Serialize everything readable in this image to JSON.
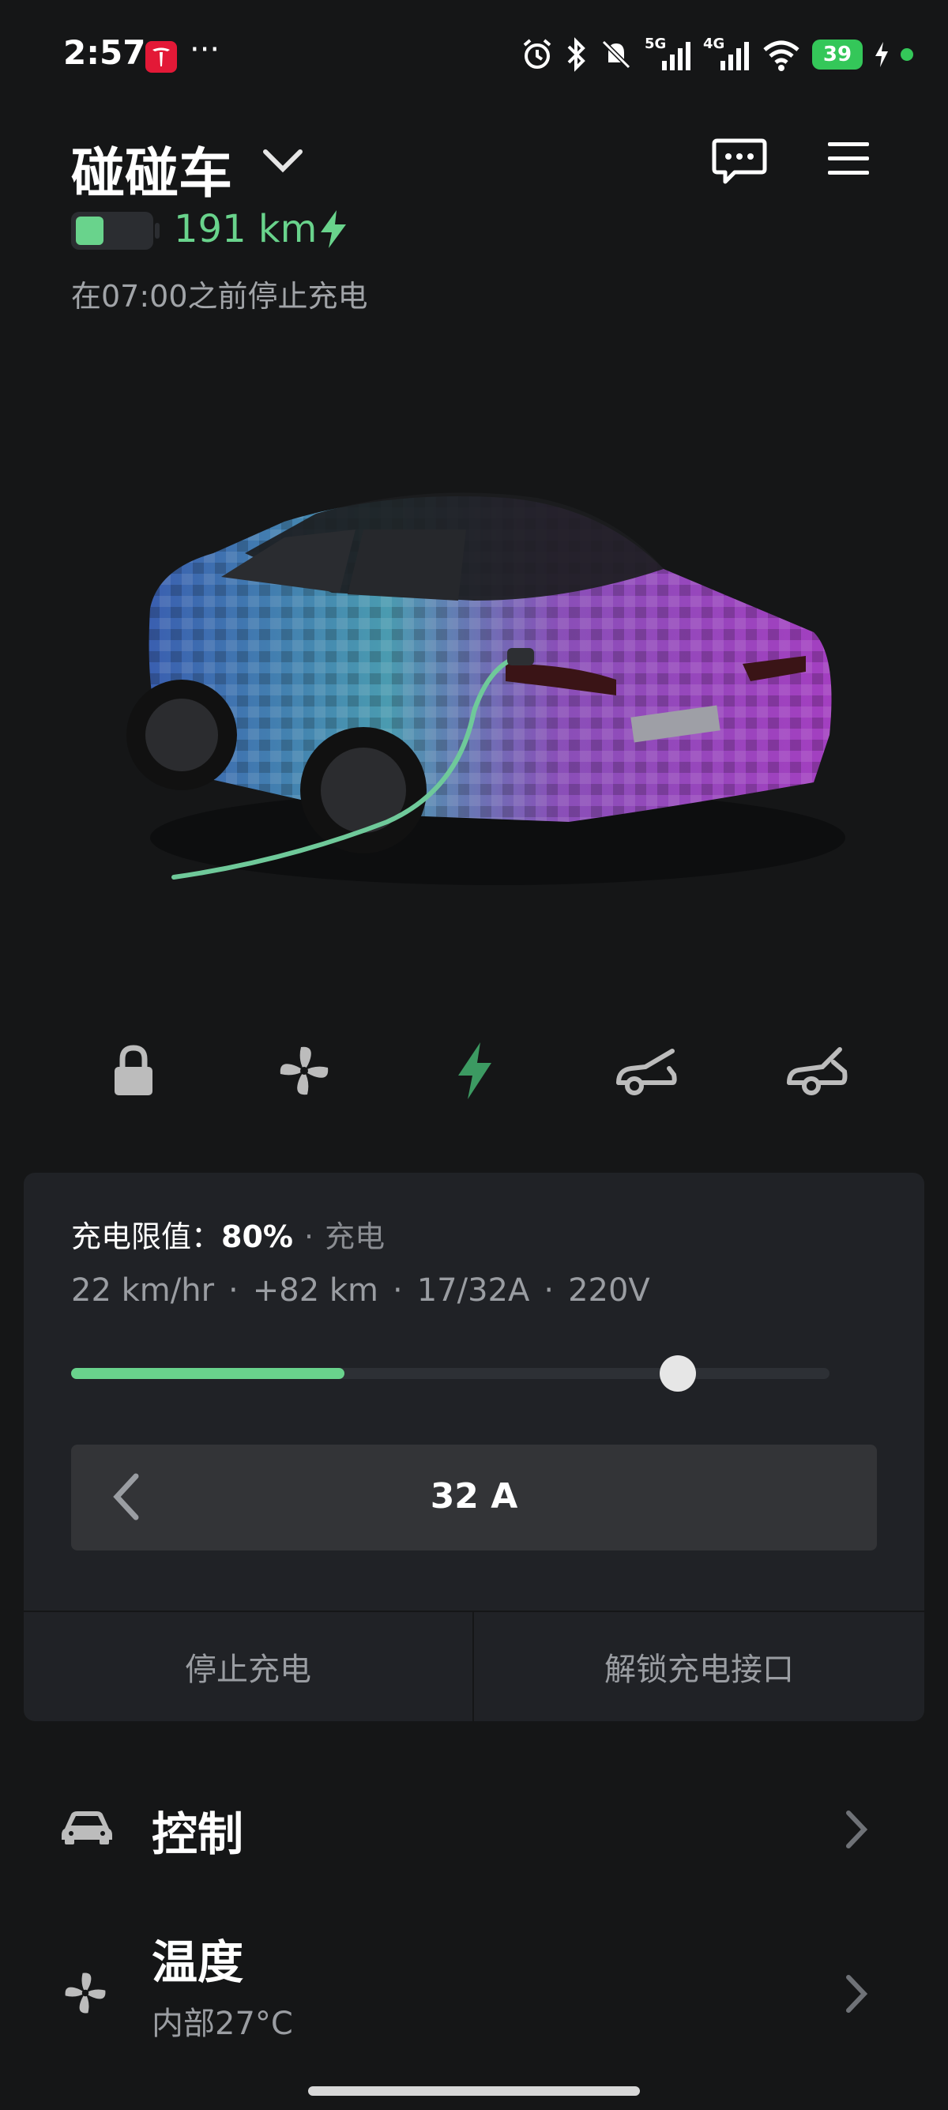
{
  "status_bar": {
    "time": "2:57",
    "more": "···",
    "network_1": "5G",
    "network_2": "4G",
    "battery": "39",
    "icons": [
      "tesla-app-icon",
      "alarm-icon",
      "bluetooth-icon",
      "silent-icon",
      "signal-5g-icon",
      "signal-4g-icon",
      "wifi-icon",
      "battery-icon",
      "charging-bolt-icon"
    ]
  },
  "header": {
    "vehicle_name": "碰碰车",
    "range": "191 km",
    "battery_level": 0.38,
    "charge_note": "在07:00之前停止充电"
  },
  "quick_controls": [
    {
      "name": "lock",
      "icon": "lock-icon"
    },
    {
      "name": "climate",
      "icon": "fan-icon"
    },
    {
      "name": "charging",
      "icon": "bolt-icon",
      "active": true
    },
    {
      "name": "frunk",
      "icon": "frunk-icon"
    },
    {
      "name": "trunk",
      "icon": "trunk-icon"
    }
  ],
  "charging": {
    "limit_label": "充电限值：",
    "limit_value": "80%",
    "dot": "·",
    "status": "充电",
    "stats": [
      "22 km/hr",
      "+82 km",
      "17/32A",
      "220V"
    ],
    "current_level": 0.36,
    "limit_level": 0.8,
    "amps": "32 A",
    "stop_button": "停止充电",
    "unlock_button": "解锁充电接口"
  },
  "menu": [
    {
      "label": "控制",
      "icon": "car-icon"
    },
    {
      "label": "温度",
      "sub": "内部27°C",
      "icon": "fan-icon"
    }
  ],
  "colors": {
    "background": "#151617",
    "card": "#202226",
    "accent_green": "#69d38c",
    "muted_text": "#9a9da2"
  }
}
